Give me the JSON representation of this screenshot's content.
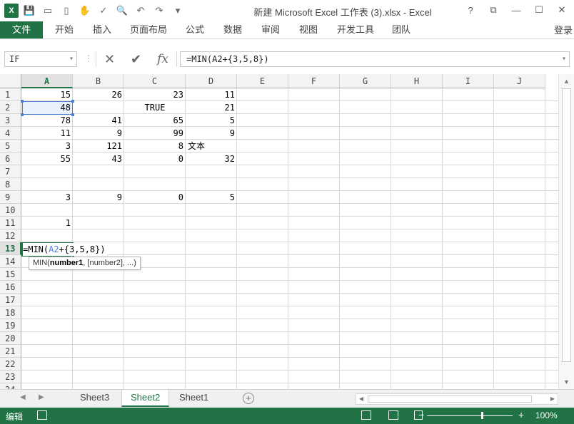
{
  "window": {
    "title": "新建 Microsoft Excel 工作表 (3).xlsx - Excel",
    "controls": [
      "?",
      "⧉",
      "—",
      "☐",
      "✕"
    ]
  },
  "ribbon": {
    "file_tab": "文件",
    "tabs": [
      "开始",
      "插入",
      "页面布局",
      "公式",
      "数据",
      "审阅",
      "视图",
      "开发工具",
      "团队"
    ],
    "login": "登录"
  },
  "formula_bar": {
    "name_box": "IF",
    "cancel_icon": "✕",
    "enter_icon": "✔",
    "fx_icon": "fx",
    "formula": "=MIN(A2+{3,5,8})"
  },
  "grid": {
    "columns": [
      "A",
      "B",
      "C",
      "D",
      "E",
      "F",
      "G",
      "H",
      "I",
      "J"
    ],
    "rows": [
      "1",
      "2",
      "3",
      "4",
      "5",
      "6",
      "7",
      "8",
      "9",
      "10",
      "11",
      "12",
      "13",
      "14",
      "15",
      "16",
      "17",
      "18",
      "19",
      "20",
      "21",
      "22",
      "23",
      "24"
    ],
    "cells": {
      "A1": "15",
      "B1": "26",
      "C1": "23",
      "D1": "11",
      "A2": "48",
      "C2": "TRUE",
      "D2": "21",
      "A3": "78",
      "B3": "41",
      "C3": "65",
      "D3": "5",
      "A4": "11",
      "B4": "9",
      "C4": "99",
      "D4": "9",
      "A5": "3",
      "B5": "121",
      "C5": "8",
      "D5": "文本",
      "A6": "55",
      "B6": "43",
      "C6": "0",
      "D6": "32",
      "A9": "3",
      "B9": "9",
      "C9": "0",
      "D9": "5",
      "A11": "1"
    },
    "editing": {
      "prefix": "=MIN(",
      "ref": "A2",
      "suffix": "+{3,5,8})"
    },
    "tooltip": {
      "func": "MIN(",
      "arg1": "number1",
      "rest": ", [number2], ...)"
    }
  },
  "sheets": {
    "tabs": [
      "Sheet3",
      "Sheet2",
      "Sheet1"
    ],
    "active": "Sheet2",
    "add_label": "+"
  },
  "status": {
    "mode": "编辑",
    "zoom": "100%",
    "zoom_minus": "−",
    "zoom_plus": "+"
  }
}
